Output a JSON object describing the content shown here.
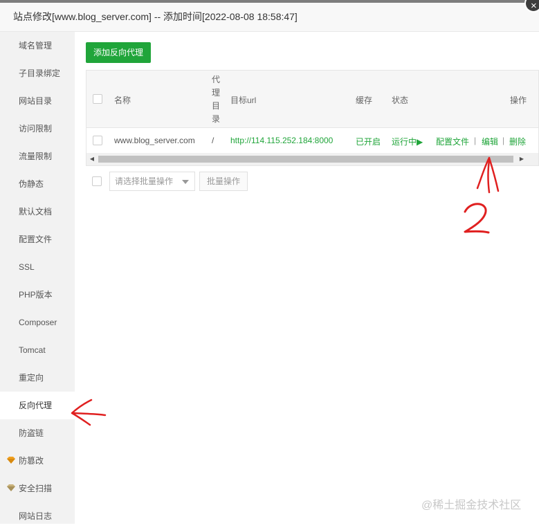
{
  "dialog": {
    "title": "站点修改[www.blog_server.com] -- 添加时间[2022-08-08 18:58:47]",
    "close_symbol": "×"
  },
  "sidebar": {
    "items": [
      {
        "label": "域名管理"
      },
      {
        "label": "子目录绑定"
      },
      {
        "label": "网站目录"
      },
      {
        "label": "访问限制"
      },
      {
        "label": "流量限制"
      },
      {
        "label": "伪静态"
      },
      {
        "label": "默认文档"
      },
      {
        "label": "配置文件"
      },
      {
        "label": "SSL"
      },
      {
        "label": "PHP版本"
      },
      {
        "label": "Composer"
      },
      {
        "label": "Tomcat"
      },
      {
        "label": "重定向"
      },
      {
        "label": "反向代理",
        "active": true
      },
      {
        "label": "防盗链"
      },
      {
        "label": "防篡改",
        "icon": "gem-icon"
      },
      {
        "label": "安全扫描",
        "icon": "gem-icon"
      },
      {
        "label": "网站日志"
      }
    ]
  },
  "toolbar": {
    "add_label": "添加反向代理"
  },
  "table": {
    "headers": {
      "name": "名称",
      "proxy_dir": "代理目录",
      "target_url": "目标url",
      "cache": "缓存",
      "status": "状态",
      "actions": "操作"
    },
    "rows": [
      {
        "name": "www.blog_server.com",
        "proxy_dir": "/",
        "target_url": "http://114.115.252.184:8000",
        "cache": "已开启",
        "status": "运行中▶",
        "action_config": "配置文件",
        "action_sep": "|",
        "action_edit": "编辑",
        "action_delete": "删除"
      }
    ]
  },
  "batch": {
    "placeholder": "请选择批量操作",
    "button_label": "批量操作"
  },
  "watermark": "@稀土掘金技术社区",
  "colors": {
    "accent": "#20a53a",
    "annotation": "#e02020"
  }
}
